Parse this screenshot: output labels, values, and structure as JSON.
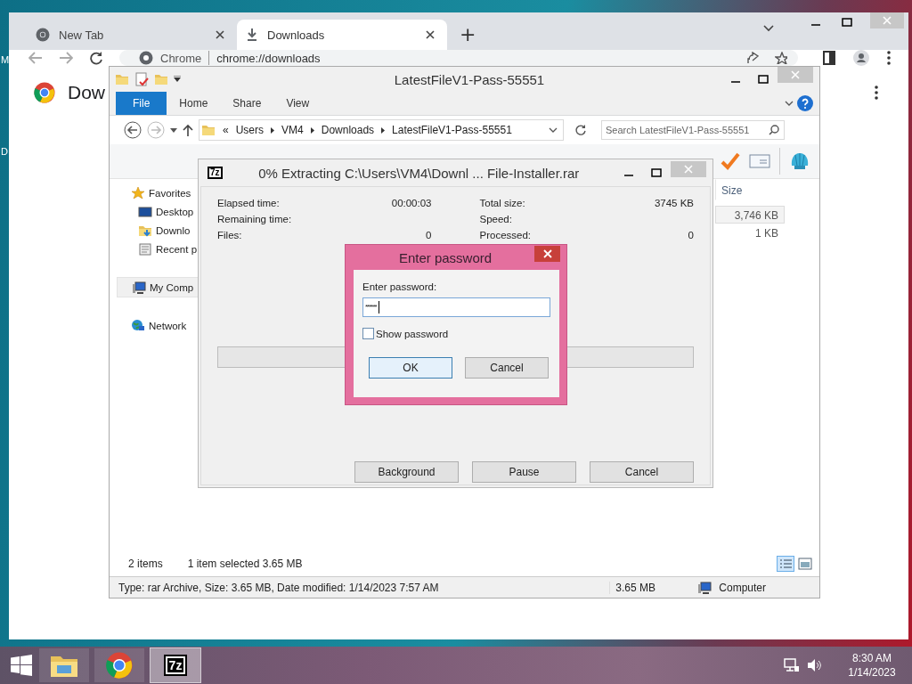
{
  "desktop_labels": [
    "M",
    "D"
  ],
  "browser": {
    "tabs": [
      {
        "label": "New Tab",
        "selected": false
      },
      {
        "label": "Downloads",
        "selected": true
      }
    ],
    "new_tab": "+",
    "address": {
      "site": "Chrome",
      "url": "chrome://downloads"
    },
    "page_heading": "Dow"
  },
  "explorer": {
    "title": "LatestFileV1-Pass-55551",
    "ribbon_tabs": [
      {
        "label": "File",
        "kind": "file"
      },
      {
        "label": "Home",
        "kind": "tab"
      },
      {
        "label": "Share",
        "kind": "tab"
      },
      {
        "label": "View",
        "kind": "tab"
      }
    ],
    "breadcrumb": [
      "«",
      "Users",
      "VM4",
      "Downloads",
      "LatestFileV1-Pass-55551"
    ],
    "search": {
      "placeholder": "Search LatestFileV1-Pass-55551"
    },
    "nav": [
      {
        "label": "Favorites",
        "kind": "star",
        "selected": false,
        "children": [
          {
            "label": "Desktop",
            "kind": "desktop",
            "selected": false
          },
          {
            "label": "Downlo",
            "kind": "downloads",
            "selected": false
          },
          {
            "label": "Recent p",
            "kind": "recent",
            "selected": false
          }
        ]
      },
      {
        "label": "My Comp",
        "kind": "computer",
        "selected": true
      },
      {
        "label": "Network",
        "kind": "network",
        "selected": false
      }
    ],
    "column_header": "Size",
    "files": [
      {
        "size": "3,746 KB",
        "selected": true
      },
      {
        "size": "1 KB",
        "selected": false
      }
    ],
    "item_count": "2 items",
    "selection_info": "1 item selected  3.65 MB",
    "details": "Type: rar Archive, Size: 3.65 MB, Date modified: 1/14/2023 7:57 AM",
    "details_size": "3.65 MB",
    "details_location": "Computer"
  },
  "extract_dialog": {
    "app_icon_text": "7z",
    "title": "0% Extracting C:\\Users\\VM4\\Downl ... File-Installer.rar",
    "stats_left": [
      {
        "label": "Elapsed time:",
        "value": "00:00:03"
      },
      {
        "label": "Remaining time:"
      },
      {
        "label": "Files:",
        "value": "0"
      }
    ],
    "stats_right": [
      {
        "label": "Total size:",
        "value": "3745 KB"
      },
      {
        "label": "Speed:"
      },
      {
        "label": "Processed:",
        "value": "0"
      }
    ],
    "progress": {
      "level": 0
    },
    "buttons": [
      "Background",
      "Pause",
      "Cancel"
    ]
  },
  "password_dialog": {
    "title": "Enter password",
    "label": "Enter password:",
    "value": "******",
    "show_password": {
      "label": "Show password",
      "checked": false
    },
    "buttons": [
      {
        "label": "OK",
        "default": true
      },
      {
        "label": "Cancel",
        "default": false
      }
    ]
  },
  "taskbar": {
    "apps": [
      {
        "kind": "explorer",
        "active": false
      },
      {
        "kind": "chrome",
        "active": false
      },
      {
        "kind": "sevenzip",
        "active": true,
        "icon_text": "7z"
      }
    ],
    "time": "8:30 AM",
    "date": "1/14/2023"
  }
}
